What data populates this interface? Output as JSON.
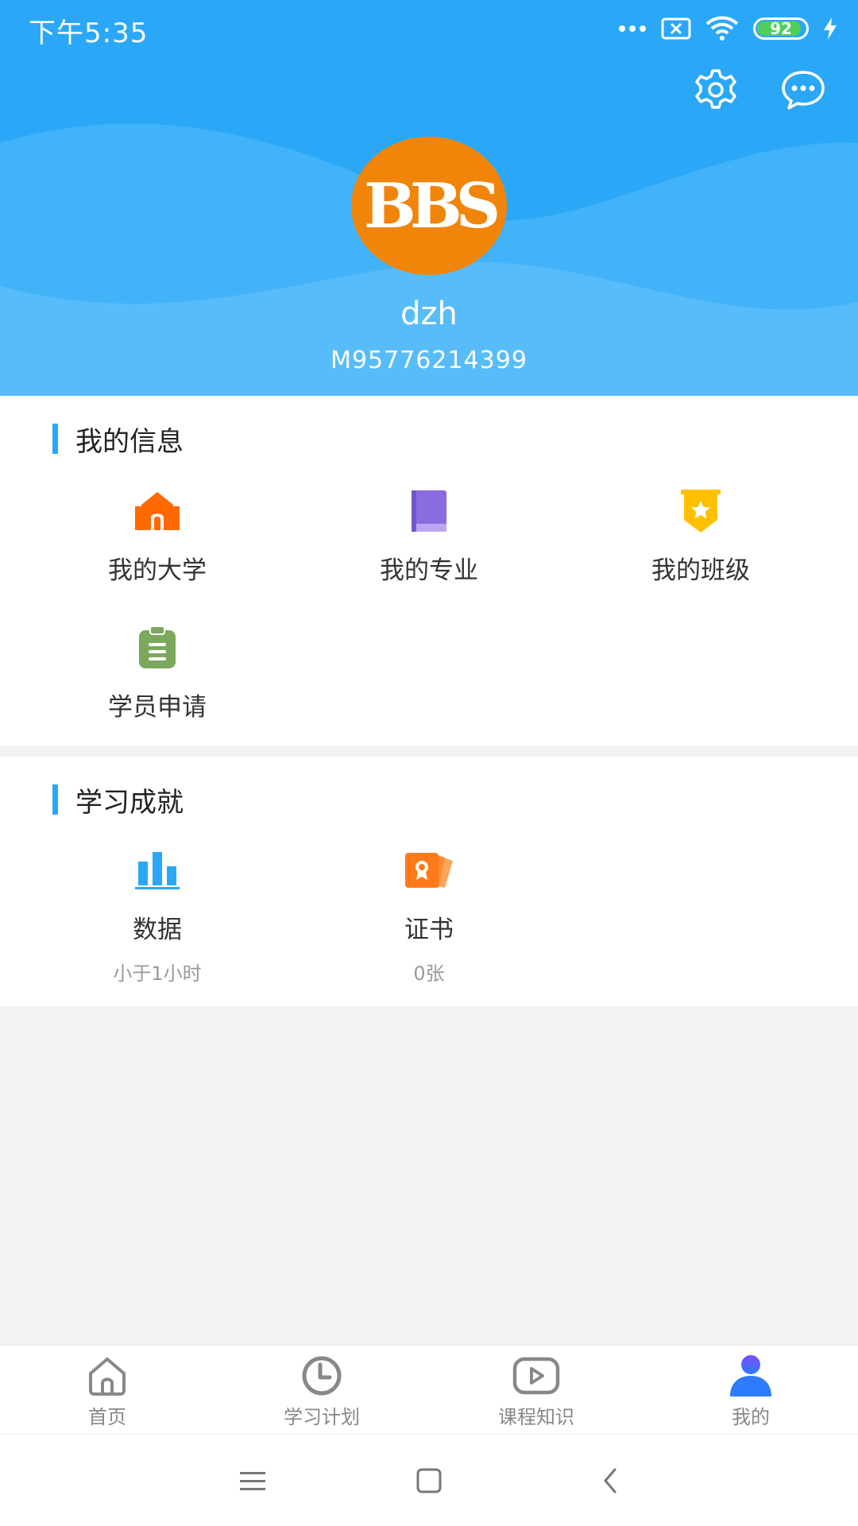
{
  "status": {
    "time": "下午5:35",
    "battery": "92",
    "battery_level": 0.92
  },
  "header": {
    "avatar_text": "BBS",
    "username": "dzh",
    "user_id": "M95776214399"
  },
  "info_section": {
    "title": "我的信息",
    "items": [
      {
        "label": "我的大学",
        "icon": "university-icon",
        "color": "#ff6a00"
      },
      {
        "label": "我的专业",
        "icon": "book-icon",
        "color": "#8a6be0"
      },
      {
        "label": "我的班级",
        "icon": "class-badge-icon",
        "color": "#ffc000"
      },
      {
        "label": "学员申请",
        "icon": "clipboard-icon",
        "color": "#7ca85b"
      }
    ]
  },
  "achievement_section": {
    "title": "学习成就",
    "items": [
      {
        "label": "数据",
        "value": "小于1小时",
        "icon": "bar-chart-icon",
        "color": "#2aa8f7"
      },
      {
        "label": "证书",
        "value": "0张",
        "icon": "certificate-icon",
        "color": "#ff7a1a"
      }
    ]
  },
  "tabs": [
    {
      "label": "首页",
      "icon": "home-icon"
    },
    {
      "label": "学习计划",
      "icon": "clock-icon"
    },
    {
      "label": "课程知识",
      "icon": "play-icon"
    },
    {
      "label": "我的",
      "icon": "user-icon",
      "active": true
    }
  ],
  "colors": {
    "primary": "#2aa8f7",
    "avatar_bg": "#f08509",
    "active_tab": "#3a6bff"
  }
}
